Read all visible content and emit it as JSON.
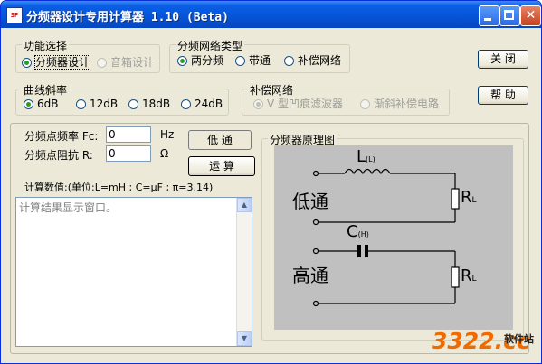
{
  "window": {
    "title": "分频器设计专用计算器  1.10 (Beta)",
    "app_icon_text": "SP"
  },
  "function_group": {
    "legend": "功能选择",
    "options": [
      "分频器设计",
      "音箱设计"
    ],
    "selected": 0
  },
  "network_type_group": {
    "legend": "分频网络类型",
    "options": [
      "两分频",
      "带通",
      "补偿网络"
    ],
    "selected": 0
  },
  "slope_group": {
    "legend": "曲线斜率",
    "options": [
      "6dB",
      "12dB",
      "18dB",
      "24dB"
    ],
    "selected": 0
  },
  "compensation_group": {
    "legend": "补偿网络",
    "options": [
      "V 型凹痕滤波器",
      "渐斜补偿电路"
    ]
  },
  "buttons": {
    "close": "关  闭",
    "help": "帮  助",
    "lowpass": "低  通",
    "calculate": "运  算"
  },
  "inputs": {
    "fc_label": "分频点频率 Fc:",
    "fc_value": "0",
    "fc_unit": "Hz",
    "r_label": "分频点阻抗 R:",
    "r_value": "0",
    "r_unit": "Ω"
  },
  "calc_note": "计算数值:(单位:L=mH  ; C=μF ;  π=3.14)",
  "output_placeholder": "计算结果显示窗口。",
  "schematic": {
    "legend": "分频器原理图",
    "low_label": "低通",
    "high_label": "高通",
    "inductor_label": "L",
    "inductor_sub": "(L)",
    "capacitor_label": "C",
    "capacitor_sub": "(H)",
    "resistor_label": "R",
    "resistor_sub": "L"
  },
  "watermark": {
    "text": "3322.cc",
    "sub": "软件站"
  },
  "colors": {
    "title_bar": "#0a5fe6",
    "window_bg": "#ece9d8",
    "watermark": "#f06a00",
    "diagram_bg": "#c0c0c0"
  }
}
